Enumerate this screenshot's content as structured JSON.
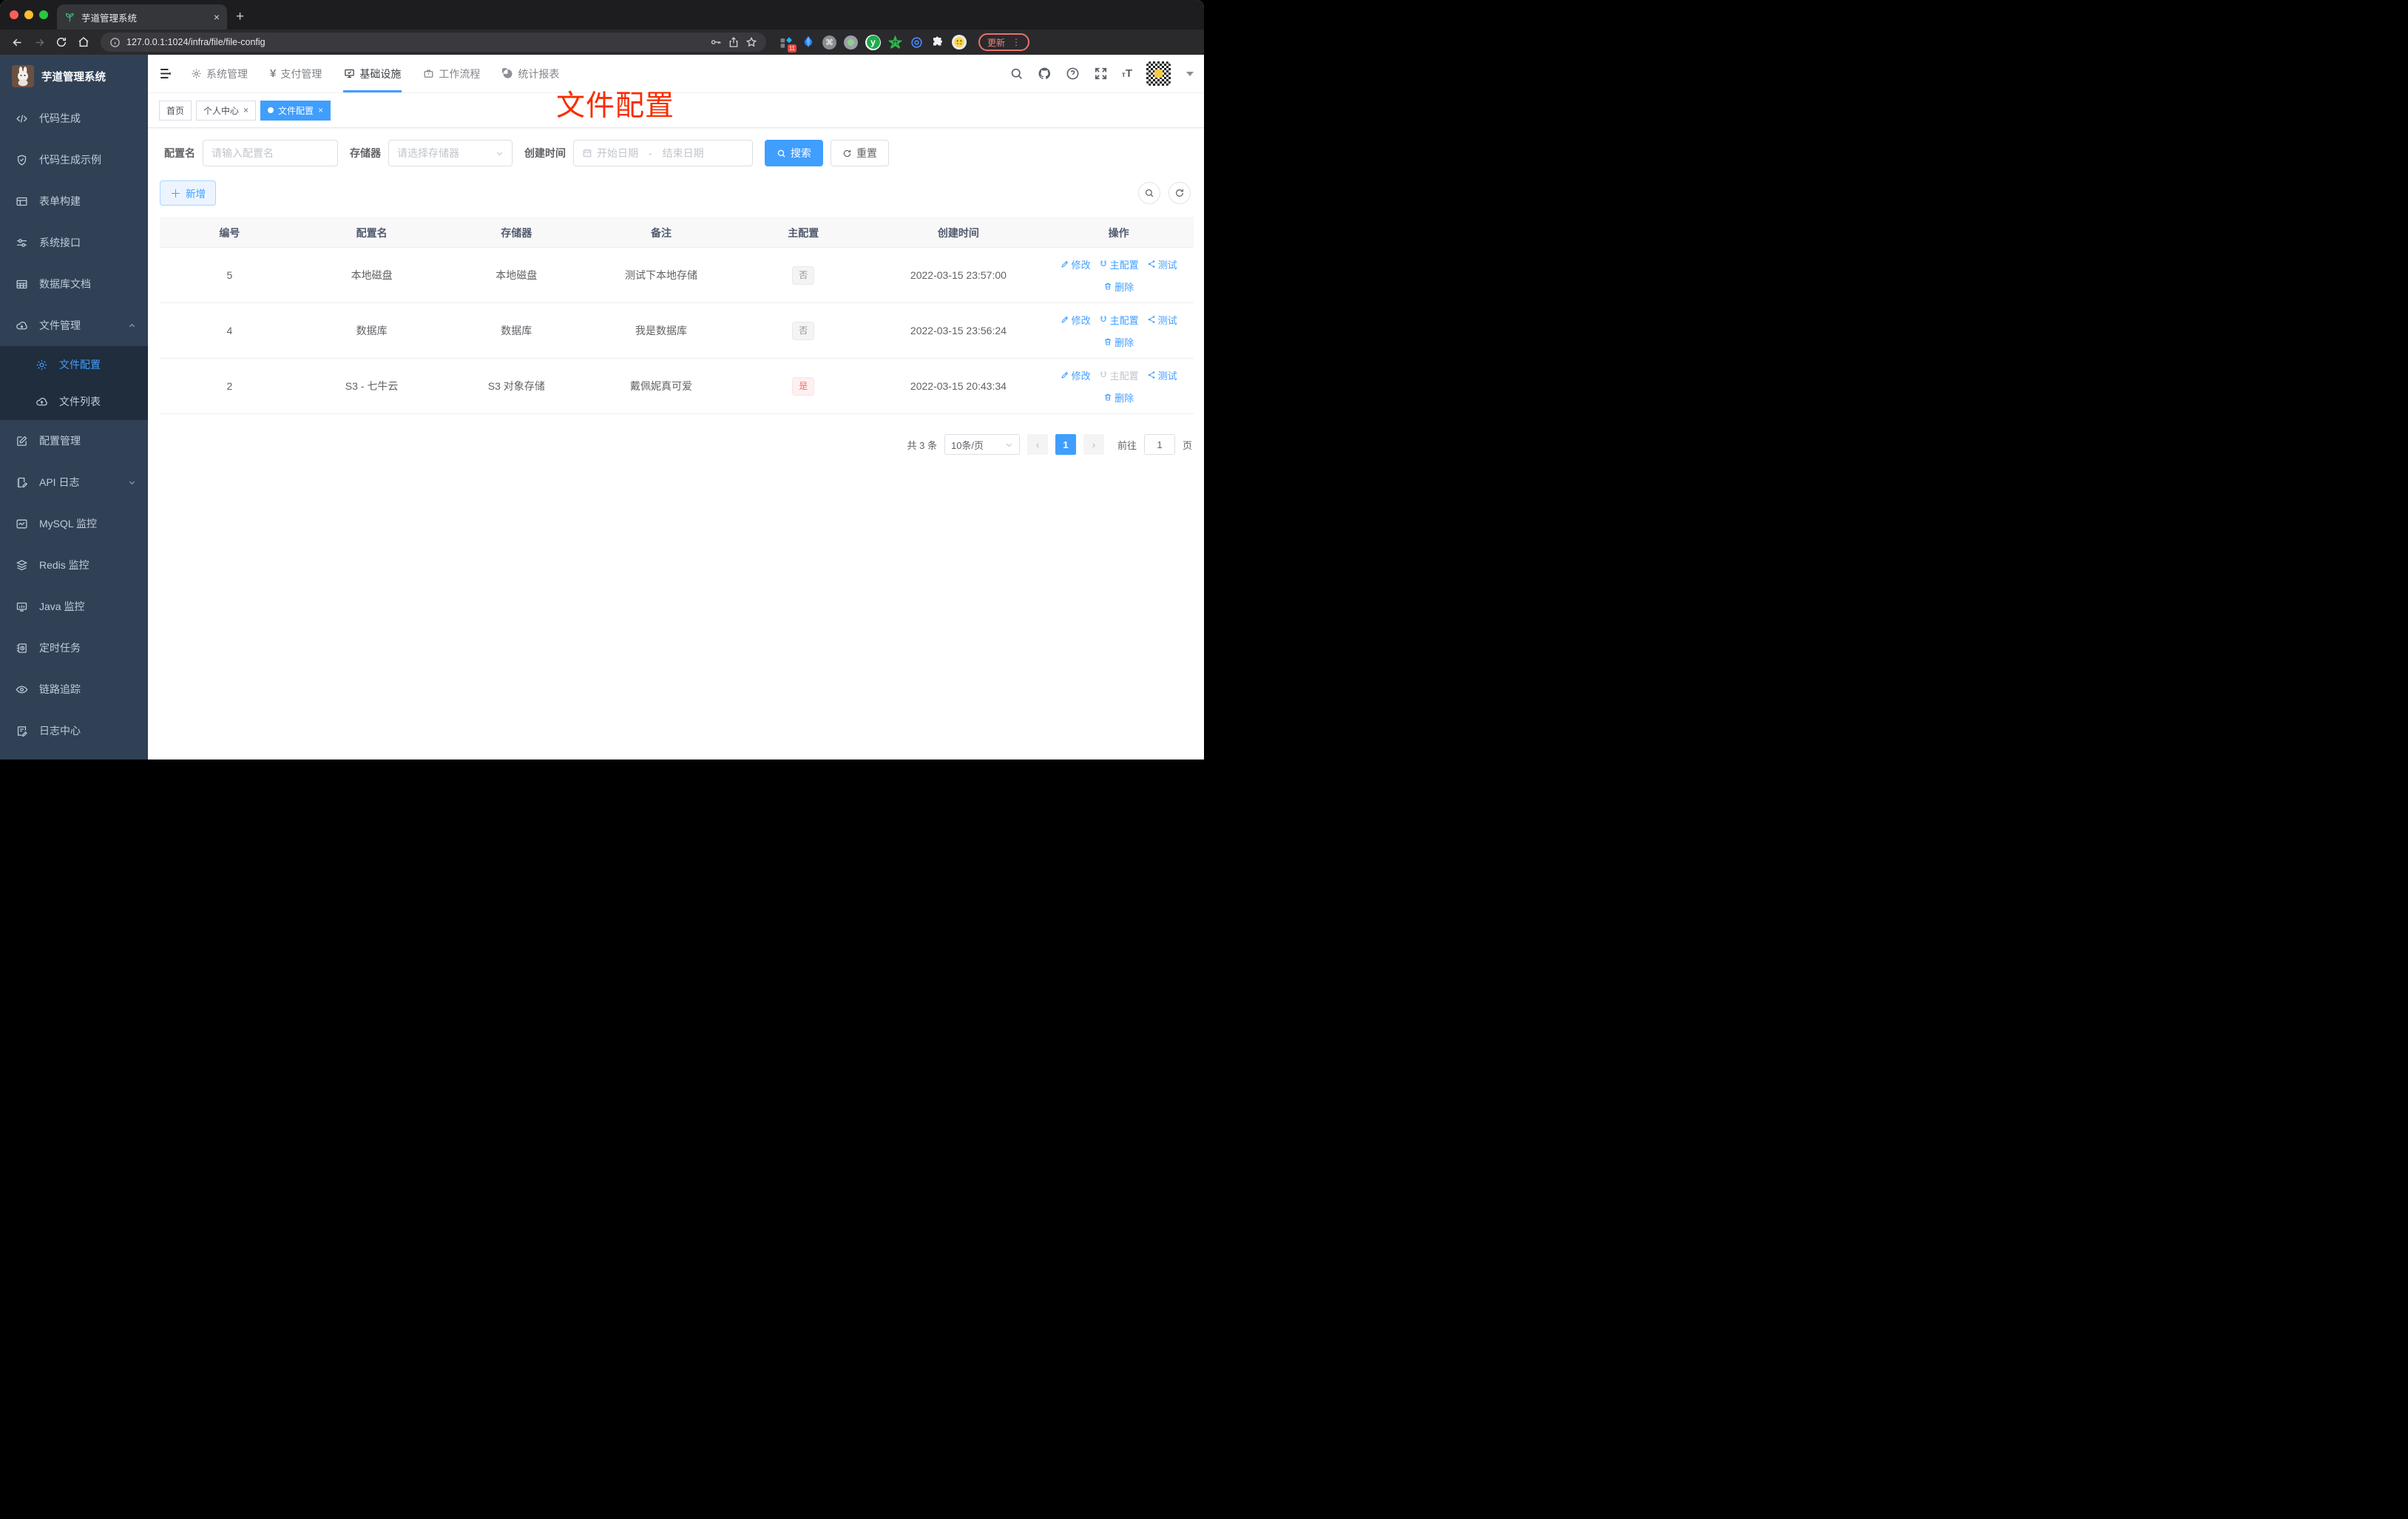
{
  "browser": {
    "tab_title": "芋道管理系统",
    "url": "127.0.0.1:1024/infra/file/file-config",
    "update_label": "更新",
    "extension_badge": "11",
    "new_tab_label": "+",
    "close_tab_label": "×"
  },
  "sidebar": {
    "logo_title": "芋道管理系统",
    "items": [
      {
        "label": "代码生成",
        "icon": "code-icon"
      },
      {
        "label": "代码生成示例",
        "icon": "shield-check-icon"
      },
      {
        "label": "表单构建",
        "icon": "form-icon"
      },
      {
        "label": "系统接口",
        "icon": "sliders-icon"
      },
      {
        "label": "数据库文档",
        "icon": "table-grid-icon"
      },
      {
        "label": "文件管理",
        "icon": "cloud-download-icon"
      },
      {
        "label": "文件配置",
        "icon": "gear-icon"
      },
      {
        "label": "文件列表",
        "icon": "cloud-upload-icon"
      },
      {
        "label": "配置管理",
        "icon": "edit-square-icon"
      },
      {
        "label": "API 日志",
        "icon": "note-edit-icon"
      },
      {
        "label": "MySQL 监控",
        "icon": "chart-frame-icon"
      },
      {
        "label": "Redis 监控",
        "icon": "layers-icon"
      },
      {
        "label": "Java 监控",
        "icon": "monitor-bars-icon"
      },
      {
        "label": "定时任务",
        "icon": "timer-doc-icon"
      },
      {
        "label": "链路追踪",
        "icon": "eye-icon"
      },
      {
        "label": "日志中心",
        "icon": "log-edit-icon"
      }
    ]
  },
  "topnav": {
    "items": [
      {
        "label": "系统管理",
        "icon": "gear-icon"
      },
      {
        "label": "支付管理",
        "icon": "yen-icon"
      },
      {
        "label": "基础设施",
        "icon": "infra-monitor-icon"
      },
      {
        "label": "工作流程",
        "icon": "briefcase-icon"
      },
      {
        "label": "统计报表",
        "icon": "dashboard-icon"
      }
    ]
  },
  "tags": {
    "items": [
      {
        "label": "首页"
      },
      {
        "label": "个人中心"
      },
      {
        "label": "文件配置"
      }
    ],
    "close_label": "×"
  },
  "annotation": {
    "text": "文件配置",
    "color": "#f72c00"
  },
  "filters": {
    "name_label": "配置名",
    "name_placeholder": "请输入配置名",
    "storage_label": "存储器",
    "storage_placeholder": "请选择存储器",
    "date_label": "创建时间",
    "date_start_placeholder": "开始日期",
    "date_separator": "-",
    "date_end_placeholder": "结束日期",
    "search_label": "搜索",
    "reset_label": "重置"
  },
  "toolbar": {
    "add_label": "新增"
  },
  "table": {
    "columns": [
      "编号",
      "配置名",
      "存储器",
      "备注",
      "主配置",
      "创建时间",
      "操作"
    ],
    "action_labels": {
      "edit": "修改",
      "master": "主配置",
      "test": "测试",
      "delete": "删除"
    },
    "rows": [
      {
        "id": "5",
        "name": "本地磁盘",
        "storage": "本地磁盘",
        "remark": "测试下本地存储",
        "master": "否",
        "created": "2022-03-15 23:57:00"
      },
      {
        "id": "4",
        "name": "数据库",
        "storage": "数据库",
        "remark": "我是数据库",
        "master": "否",
        "created": "2022-03-15 23:56:24"
      },
      {
        "id": "2",
        "name": "S3 - 七牛云",
        "storage": "S3 对象存储",
        "remark": "戴佩妮真可爱",
        "master": "是",
        "created": "2022-03-15 20:43:34"
      }
    ]
  },
  "pagination": {
    "total": "共 3 条",
    "page_size": "10条/页",
    "page": "1",
    "goto_label": "前往",
    "goto_value": "1",
    "page_unit": "页"
  },
  "colors": {
    "accent": "#409eff",
    "danger": "#f56c6c",
    "sidebar_bg": "#304156",
    "submenu_bg": "#1f2d3d",
    "annotation": "#f72c00"
  }
}
